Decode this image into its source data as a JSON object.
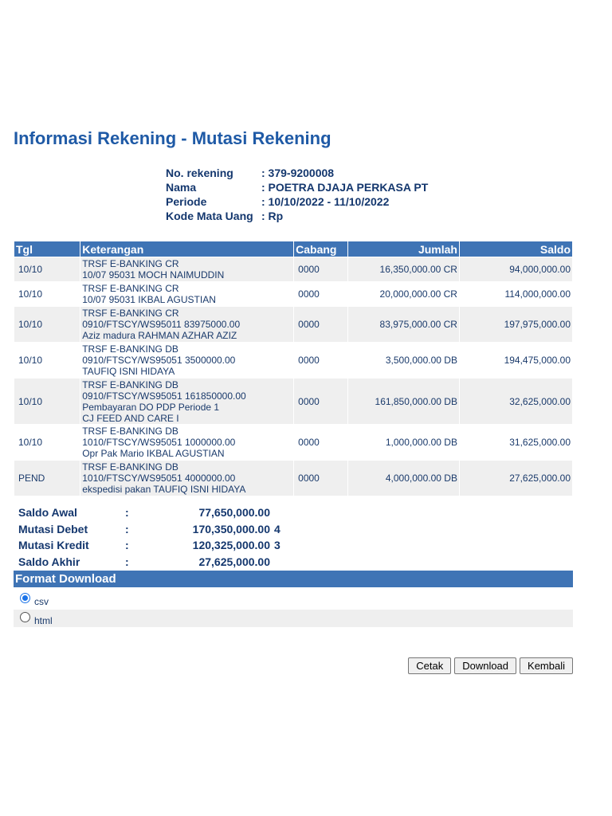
{
  "page": {
    "title": "Informasi Rekening - Mutasi Rekening"
  },
  "account_info": [
    {
      "label": "No. rekening",
      "value": ": 379-9200008"
    },
    {
      "label": "Nama",
      "value": ": POETRA DJAJA PERKASA PT"
    },
    {
      "label": "Periode",
      "value": ": 10/10/2022 - 11/10/2022"
    },
    {
      "label": "Kode Mata Uang",
      "value": ": Rp"
    }
  ],
  "table": {
    "headers": [
      "Tgl",
      "Keterangan",
      "Cabang",
      "Jumlah",
      "Saldo"
    ],
    "rows": [
      {
        "tgl": "10/10",
        "ket": [
          "TRSF E-BANKING CR",
          "10/07 95031 MOCH NAIMUDDIN"
        ],
        "cabang": "0000",
        "jumlah": "16,350,000.00 CR",
        "saldo": "94,000,000.00"
      },
      {
        "tgl": "10/10",
        "ket": [
          "TRSF E-BANKING CR",
          "10/07 95031 IKBAL AGUSTIAN"
        ],
        "cabang": "0000",
        "jumlah": "20,000,000.00 CR",
        "saldo": "114,000,000.00"
      },
      {
        "tgl": "10/10",
        "ket": [
          "TRSF E-BANKING CR",
          "0910/FTSCY/WS95011 83975000.00",
          "Aziz madura RAHMAN AZHAR AZIZ"
        ],
        "cabang": "0000",
        "jumlah": "83,975,000.00 CR",
        "saldo": "197,975,000.00"
      },
      {
        "tgl": "10/10",
        "ket": [
          "TRSF E-BANKING DB",
          "0910/FTSCY/WS95051 3500000.00",
          "TAUFIQ ISNI HIDAYA"
        ],
        "cabang": "0000",
        "jumlah": "3,500,000.00 DB",
        "saldo": "194,475,000.00"
      },
      {
        "tgl": "10/10",
        "ket": [
          "TRSF E-BANKING DB",
          "0910/FTSCY/WS95051 161850000.00",
          "Pembayaran DO PDP Periode 1",
          "CJ FEED AND CARE I"
        ],
        "cabang": "0000",
        "jumlah": "161,850,000.00 DB",
        "saldo": "32,625,000.00"
      },
      {
        "tgl": "10/10",
        "ket": [
          "TRSF E-BANKING DB",
          "1010/FTSCY/WS95051 1000000.00",
          "Opr Pak Mario IKBAL AGUSTIAN"
        ],
        "cabang": "0000",
        "jumlah": "1,000,000.00 DB",
        "saldo": "31,625,000.00"
      },
      {
        "tgl": "PEND",
        "ket": [
          "TRSF E-BANKING DB",
          "1010/FTSCY/WS95051 4000000.00",
          "ekspedisi pakan TAUFIQ ISNI HIDAYA"
        ],
        "cabang": "0000",
        "jumlah": "4,000,000.00 DB",
        "saldo": "27,625,000.00"
      }
    ]
  },
  "summary": [
    {
      "label": "Saldo Awal",
      "colon": ":",
      "value": "77,650,000.00",
      "extra": ""
    },
    {
      "label": "Mutasi Debet",
      "colon": ":",
      "value": "170,350,000.00",
      "extra": "4"
    },
    {
      "label": "Mutasi Kredit",
      "colon": ":",
      "value": "120,325,000.00",
      "extra": "3"
    },
    {
      "label": "Saldo Akhir",
      "colon": ":",
      "value": "27,625,000.00",
      "extra": ""
    }
  ],
  "format_download": {
    "title": "Format Download",
    "options": [
      {
        "label": "csv",
        "checked": true
      },
      {
        "label": "html",
        "checked": false
      }
    ]
  },
  "buttons": {
    "cetak": "Cetak",
    "download": "Download",
    "kembali": "Kembali"
  }
}
